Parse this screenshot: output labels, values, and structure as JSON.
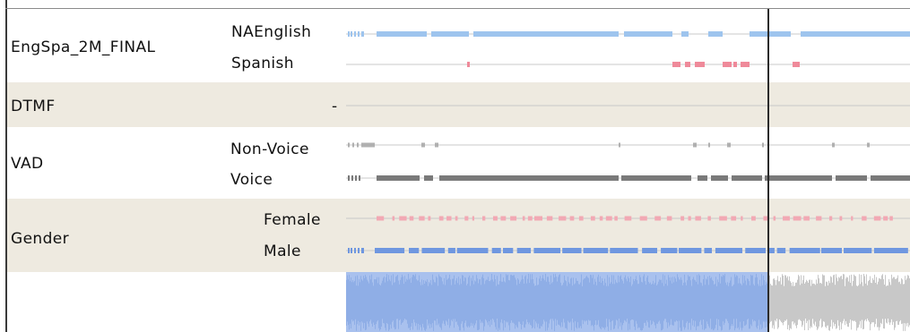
{
  "rows": [
    {
      "group_label": "EngSpa_2M_FINAL",
      "band": "white",
      "sub_labels": [
        "NAEnglish",
        "Spanish"
      ]
    },
    {
      "group_label": "DTMF",
      "band": "tan",
      "sub_labels": [
        "-"
      ]
    },
    {
      "group_label": "VAD",
      "band": "white",
      "sub_labels": [
        "Non-Voice",
        "Voice"
      ]
    },
    {
      "group_label": "Gender",
      "band": "tan",
      "sub_labels": [
        "Female",
        "Male"
      ]
    }
  ],
  "colors": {
    "english": "#9ec4ee",
    "spanish": "#ef8a9a",
    "voice": "#7a7a7a",
    "nonvoice": "#b0b0b0",
    "female": "#f2a9b4",
    "male": "#6f97e0",
    "wave_played": "#8faee6",
    "wave_unplayed": "#c8c8c8",
    "cursor": "#2b2b2b",
    "tan_band": "#eeeae0",
    "baseline": "#c8c8c8"
  }
}
